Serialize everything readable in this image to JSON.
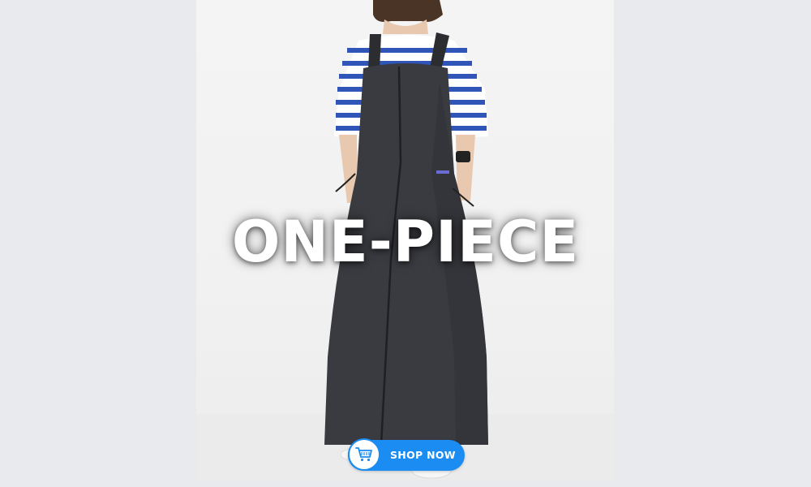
{
  "banner": {
    "headline": "ONE-PIECE",
    "cta_label": "SHOP NOW",
    "cta_icon": "shopping-cart-icon"
  },
  "colors": {
    "background": "#e9eaee",
    "dress": "#3a3b40",
    "stripe_blue": "#2f55b8",
    "cta_blue": "#1a8cf2",
    "headline": "#ffffff"
  }
}
